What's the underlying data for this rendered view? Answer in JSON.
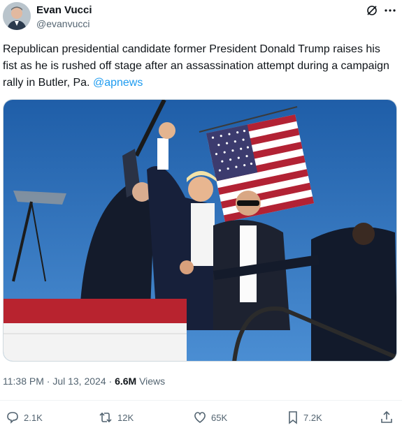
{
  "author": {
    "name": "Evan Vucci",
    "handle": "@evanvucci"
  },
  "icons": {
    "grok": "grok-icon",
    "more": "more-icon",
    "reply": "reply-icon",
    "retweet": "retweet-icon",
    "like": "like-icon",
    "bookmark": "bookmark-icon",
    "share": "share-icon"
  },
  "tweet": {
    "text": "Republican presidential candidate former President Donald Trump raises his fist as he is rushed off stage  after an assassination attempt during a campaign rally in Butler, Pa. ",
    "mention": "@apnews"
  },
  "meta": {
    "timestamp": "11:38 PM · Jul 13, 2024 · ",
    "views_count": "6.6M",
    "views_label": " Views"
  },
  "actions": {
    "replies": "2.1K",
    "retweets": "12K",
    "likes": "65K",
    "bookmarks": "7.2K"
  },
  "colors": {
    "text": "#0f1419",
    "secondary": "#536471",
    "link": "#1d9bf0",
    "sky": "#2e6fb5"
  }
}
